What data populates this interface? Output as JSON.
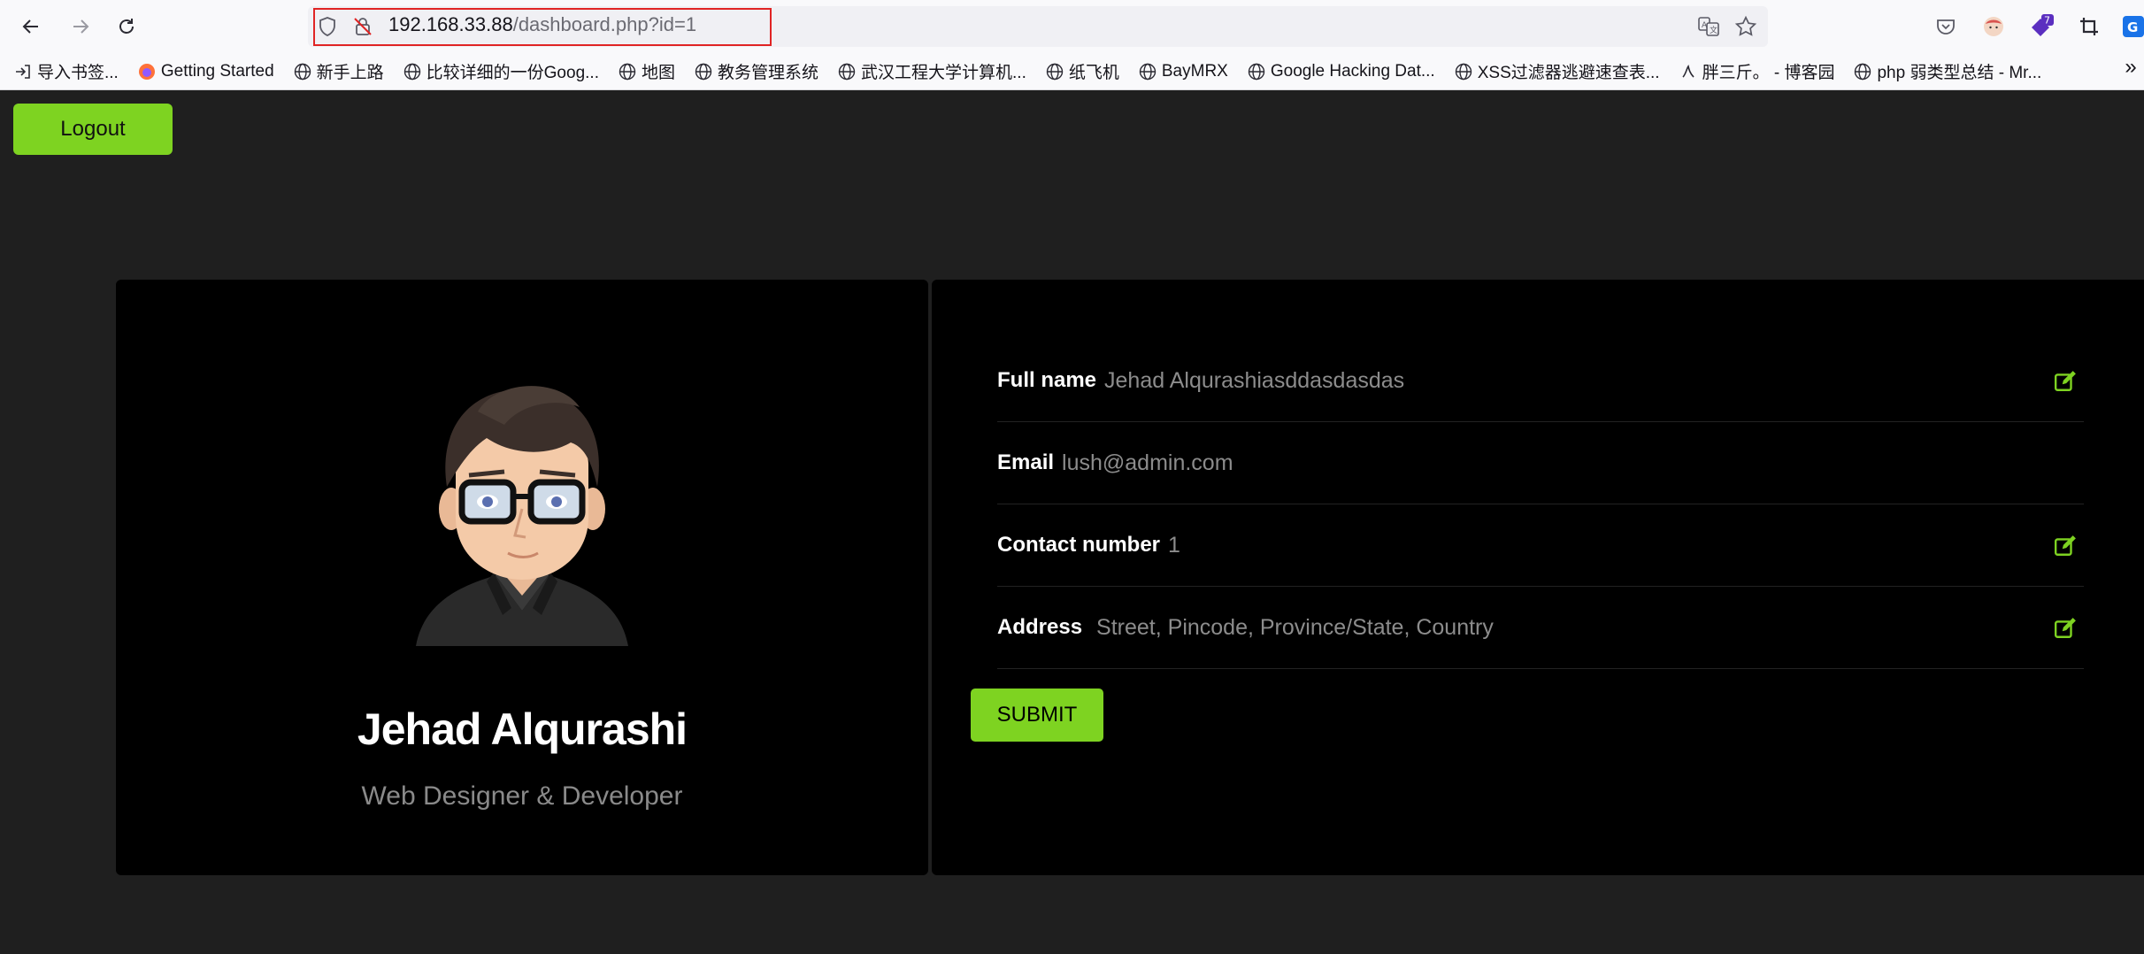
{
  "browser": {
    "url_host": "192.168.33.88",
    "url_path": "/dashboard.php?id=1",
    "bookmarks": [
      {
        "label": "导入书签..."
      },
      {
        "label": "Getting Started"
      },
      {
        "label": "新手上路"
      },
      {
        "label": "比较详细的一份Goog..."
      },
      {
        "label": "地图"
      },
      {
        "label": "教务管理系统"
      },
      {
        "label": "武汉工程大学计算机..."
      },
      {
        "label": "纸飞机"
      },
      {
        "label": "BayMRX"
      },
      {
        "label": "Google Hacking Dat..."
      },
      {
        "label": "XSS过滤器逃避速查表..."
      },
      {
        "label": "胖三斤。 - 博客园"
      },
      {
        "label": "php 弱类型总结 - Mr..."
      }
    ],
    "extension_badge": "7",
    "more_chevron": "»"
  },
  "page": {
    "logout_label": "Logout",
    "profile": {
      "name": "Jehad Alqurashi",
      "role": "Web Designer & Developer"
    },
    "fields": [
      {
        "label": "Full name",
        "value": "Jehad Alqurashiasddasdasdas",
        "editable": true
      },
      {
        "label": "Email",
        "value": "lush@admin.com",
        "editable": false
      },
      {
        "label": "Contact number",
        "value": "1",
        "editable": true
      },
      {
        "label": "Address",
        "value": "Street, Pincode, Province/State, Country",
        "editable": true
      }
    ],
    "submit_label": "SUBMIT"
  },
  "colors": {
    "accent": "#7ed321",
    "background": "#1f1f1f",
    "card": "#000000",
    "url_highlight": "#e02424"
  }
}
